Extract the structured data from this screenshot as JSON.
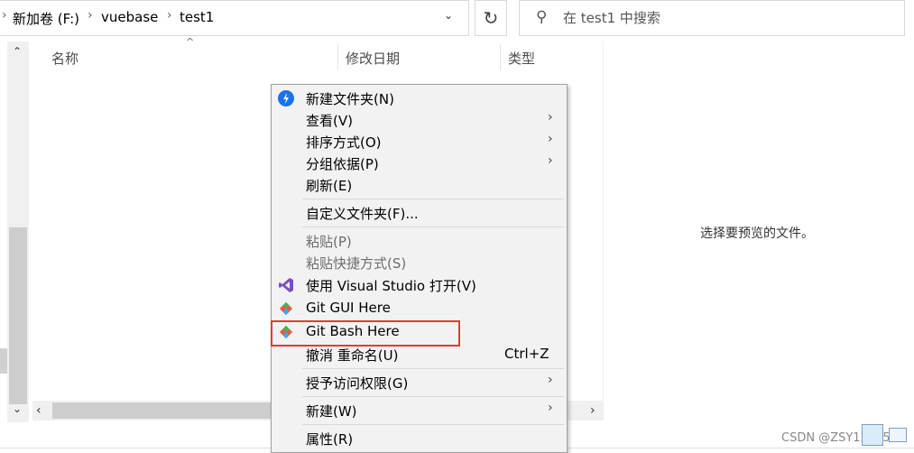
{
  "address_bar": {
    "breadcrumbs": [
      "新加卷 (F:)",
      "vuebase",
      "test1"
    ]
  },
  "search": {
    "placeholder": "在 test1 中搜索"
  },
  "columns": [
    "名称",
    "修改日期",
    "类型"
  ],
  "preview_message": "选择要预览的文件。",
  "context_menu": {
    "items": [
      {
        "label": "新建文件夹(N)",
        "icon": "new-folder-icon"
      },
      {
        "label": "查看(V)",
        "submenu": true
      },
      {
        "label": "排序方式(O)",
        "submenu": true
      },
      {
        "label": "分组依据(P)",
        "submenu": true
      },
      {
        "label": "刷新(E)"
      },
      {
        "label": "自定义文件夹(F)..."
      },
      {
        "label": "粘贴(P)",
        "disabled": true
      },
      {
        "label": "粘贴快捷方式(S)",
        "disabled": true
      },
      {
        "label": "使用 Visual Studio 打开(V)",
        "icon": "visual-studio-icon"
      },
      {
        "label": "Git GUI Here",
        "icon": "git-icon"
      },
      {
        "label": "Git Bash Here",
        "icon": "git-icon",
        "highlighted": true
      },
      {
        "label": "撤消 重命名(U)",
        "shortcut": "Ctrl+Z"
      },
      {
        "label": "授予访问权限(G)",
        "submenu": true
      },
      {
        "label": "新建(W)",
        "submenu": true
      },
      {
        "label": "属性(R)"
      }
    ]
  },
  "watermark": "CSDN @ZSY123357",
  "colors": {
    "highlight_border": "#e53935",
    "vs_purple": "#7b4fbf",
    "shield_blue": "#1a73e8"
  }
}
